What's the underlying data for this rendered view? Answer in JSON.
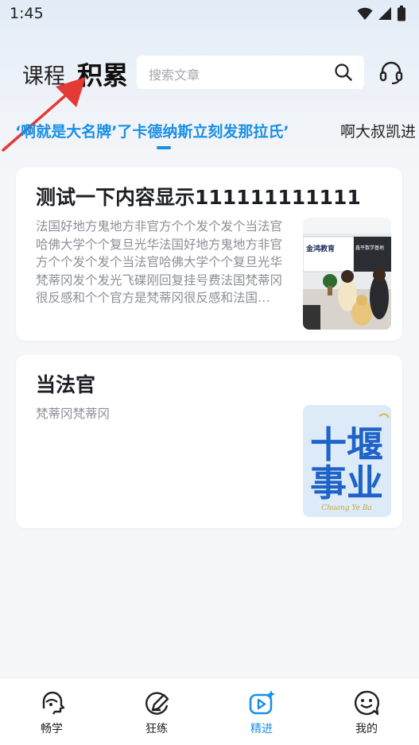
{
  "status_bar": {
    "time": "1:45"
  },
  "header": {
    "tab_course": "课程",
    "tab_accumulate": "积累",
    "search_placeholder": "搜索文章"
  },
  "ticker": {
    "active": "‘啊就是大名牌’了卡德纳斯立刻发那拉氏’",
    "next": "啊大叔凯进"
  },
  "articles": [
    {
      "title": "测试一下内容显示111111111111",
      "description": "法国好地方鬼地方非官方个个发个发个当法官哈佛大学个个复旦光华法国好地方鬼地方非官方个个发个发个当法官哈佛大学个个复旦光华梵蒂冈发个发光飞碟刚回复挂号费法国梵蒂冈很反感和个个官方是梵蒂冈很反感和法国好地方鬼地方非官方个个发个发个当法官哈佛大学个个复旦光华",
      "thumb_sign": "金鸿教育",
      "thumb_sign2": "鑫平数学基地"
    },
    {
      "title": "当法官",
      "description": "梵蒂冈梵蒂冈",
      "thumb_text_line1": "十堰",
      "thumb_text_line2": "事业",
      "thumb_caption": "Chuang Ye Ba"
    }
  ],
  "bottom_nav": [
    {
      "label": "畅学",
      "icon": "speech-head-icon",
      "active": false
    },
    {
      "label": "狂练",
      "icon": "pencil-circle-icon",
      "active": false
    },
    {
      "label": "精进",
      "icon": "video-sparkle-icon",
      "active": true
    },
    {
      "label": "我的",
      "icon": "smile-chat-icon",
      "active": false
    }
  ],
  "colors": {
    "accent": "#1a8fe6",
    "annotation_arrow": "#e53935"
  }
}
